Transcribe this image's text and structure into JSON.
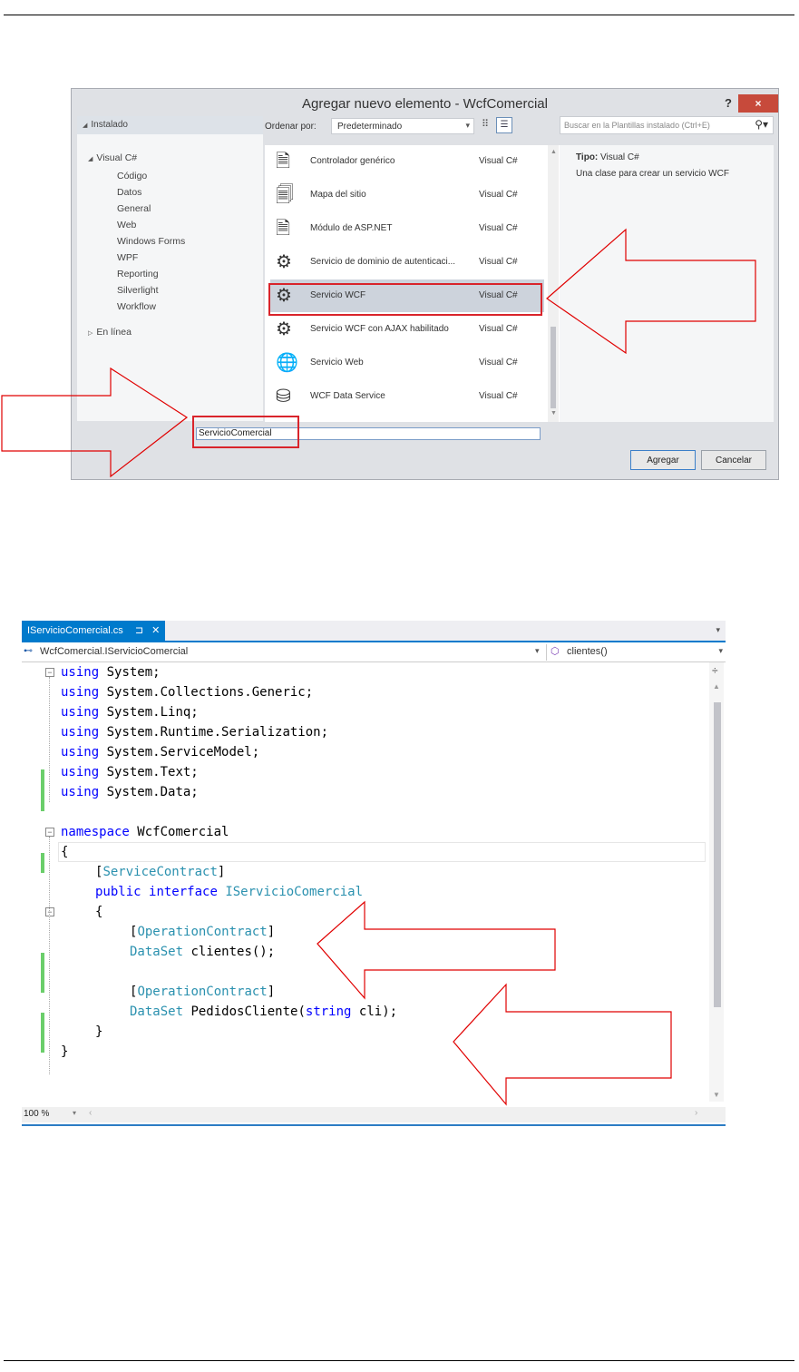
{
  "dialog": {
    "title": "Agregar nuevo elemento - WcfComercial",
    "help": "?",
    "close": "×",
    "installed": "Instalado",
    "sort_label": "Ordenar por:",
    "sort_value": "Predeterminado",
    "search_placeholder": "Buscar en la Plantillas instalado (Ctrl+E)",
    "tree": {
      "root": "Visual C#",
      "children": [
        "Código",
        "Datos",
        "General",
        "Web",
        "Windows Forms",
        "WPF",
        "Reporting",
        "Silverlight",
        "Workflow"
      ],
      "online": "En línea"
    },
    "templates": [
      {
        "name": "Controlador genérico",
        "lang": "Visual C#",
        "icon": "handler-icon"
      },
      {
        "name": "Mapa del sitio",
        "lang": "Visual C#",
        "icon": "sitemap-icon"
      },
      {
        "name": "Módulo de ASP.NET",
        "lang": "Visual C#",
        "icon": "module-icon"
      },
      {
        "name": "Servicio de dominio de autenticaci...",
        "lang": "Visual C#",
        "icon": "gear-icon"
      },
      {
        "name": "Servicio WCF",
        "lang": "Visual C#",
        "icon": "gear-icon",
        "selected": true
      },
      {
        "name": "Servicio WCF con AJAX habilitado",
        "lang": "Visual C#",
        "icon": "gear-icon"
      },
      {
        "name": "Servicio Web",
        "lang": "Visual C#",
        "icon": "globe-icon"
      },
      {
        "name": "WCF Data Service",
        "lang": "Visual C#",
        "icon": "database-icon"
      }
    ],
    "details": {
      "type_label": "Tipo:",
      "type_value": "Visual C#",
      "description": "Una clase para crear un servicio WCF"
    },
    "name_value": "ServicioComercial",
    "add_button": "Agregar",
    "cancel_button": "Cancelar"
  },
  "editor": {
    "tab_label": "IServicioComercial.cs",
    "pin": "⊐",
    "tab_close": "✕",
    "nav_type": "WcfComercial.IServicioComercial",
    "nav_member": "clientes()",
    "zoom": "100 %",
    "lines": [
      {
        "indent": 0,
        "tokens": [
          [
            "kw",
            "using"
          ],
          [
            "",
            "System;"
          ]
        ]
      },
      {
        "indent": 0,
        "tokens": [
          [
            "kw",
            "using"
          ],
          [
            "",
            "System.Collections.Generic;"
          ]
        ]
      },
      {
        "indent": 0,
        "tokens": [
          [
            "kw",
            "using"
          ],
          [
            "",
            "System.Linq;"
          ]
        ]
      },
      {
        "indent": 0,
        "tokens": [
          [
            "kw",
            "using"
          ],
          [
            "",
            "System.Runtime.Serialization;"
          ]
        ]
      },
      {
        "indent": 0,
        "tokens": [
          [
            "kw",
            "using"
          ],
          [
            "",
            "System.ServiceModel;"
          ]
        ]
      },
      {
        "indent": 0,
        "tokens": [
          [
            "kw",
            "using"
          ],
          [
            "",
            "System.Text;"
          ]
        ]
      },
      {
        "indent": 0,
        "tokens": [
          [
            "kw",
            "using"
          ],
          [
            "",
            "System.Data;"
          ]
        ]
      },
      {
        "indent": 0,
        "tokens": []
      },
      {
        "indent": 0,
        "tokens": [
          [
            "kw",
            "namespace"
          ],
          [
            "",
            "WcfComercial"
          ]
        ]
      },
      {
        "indent": 0,
        "tokens": [
          [
            "",
            "{"
          ]
        ]
      },
      {
        "indent": 1,
        "tokens": [
          [
            "",
            "["
          ],
          [
            "ty",
            "ServiceContract"
          ],
          [
            "",
            "]"
          ]
        ]
      },
      {
        "indent": 1,
        "tokens": [
          [
            "kw",
            "public"
          ],
          [
            "kw",
            "interface"
          ],
          [
            "ty",
            "IServicioComercial"
          ]
        ]
      },
      {
        "indent": 1,
        "tokens": [
          [
            "",
            "{"
          ]
        ]
      },
      {
        "indent": 2,
        "tokens": [
          [
            "",
            "["
          ],
          [
            "ty",
            "OperationContract"
          ],
          [
            "",
            "]"
          ]
        ]
      },
      {
        "indent": 2,
        "tokens": [
          [
            "ty",
            "DataSet"
          ],
          [
            "",
            "clientes();"
          ]
        ]
      },
      {
        "indent": 0,
        "tokens": []
      },
      {
        "indent": 2,
        "tokens": [
          [
            "",
            "["
          ],
          [
            "ty",
            "OperationContract"
          ],
          [
            "",
            "]"
          ]
        ]
      },
      {
        "indent": 2,
        "tokens": [
          [
            "ty",
            "DataSet"
          ],
          [
            "",
            "PedidosCliente("
          ],
          [
            "kw",
            "string"
          ],
          [
            "",
            "cli);"
          ]
        ]
      },
      {
        "indent": 1,
        "tokens": [
          [
            "",
            "}"
          ]
        ]
      },
      {
        "indent": 0,
        "tokens": [
          [
            "",
            "}"
          ]
        ]
      }
    ]
  }
}
